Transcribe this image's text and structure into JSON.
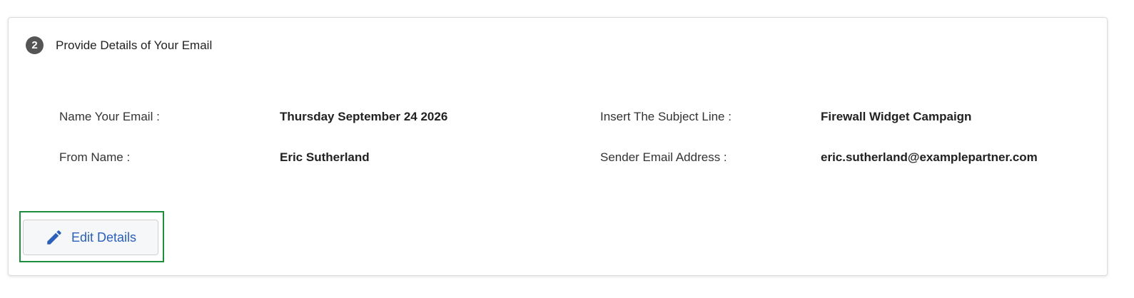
{
  "step": {
    "number": "2",
    "title": "Provide Details of Your Email"
  },
  "details": {
    "name_label": "Name Your Email :",
    "name_value": "Thursday September 24 2026",
    "subject_label": "Insert The Subject Line :",
    "subject_value": "Firewall Widget Campaign",
    "from_label": "From Name :",
    "from_value": "Eric Sutherland",
    "sender_label": "Sender Email Address :",
    "sender_value": "eric.sutherland@examplepartner.com"
  },
  "actions": {
    "edit_label": "Edit Details",
    "edit_icon": "pencil-icon"
  },
  "colors": {
    "accent": "#2a5fba",
    "highlight_border": "#1e8e3e",
    "step_badge": "#555555"
  }
}
